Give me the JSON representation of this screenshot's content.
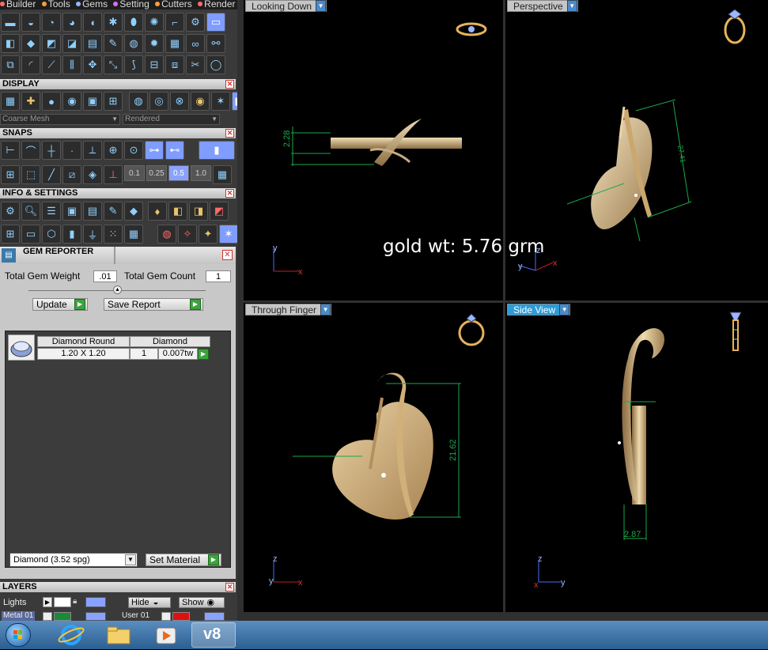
{
  "menubar": {
    "items": [
      {
        "label": "Builder"
      },
      {
        "label": "Tools"
      },
      {
        "label": "Gems"
      },
      {
        "label": "Setting"
      },
      {
        "label": "Cutters"
      },
      {
        "label": "Render"
      }
    ]
  },
  "display": {
    "title": "DISPLAY",
    "mesh_select": "Coarse Mesh",
    "render_select": "Rendered"
  },
  "snaps": {
    "title": "SNAPS",
    "values": [
      "0.1",
      "0.25",
      "0.5",
      "1.0"
    ],
    "selected": "0.5"
  },
  "info": {
    "title": "INFO & SETTINGS"
  },
  "gem_reporter": {
    "title": "GEM REPORTER",
    "total_weight_label": "Total Gem Weight",
    "total_weight_value": ".01",
    "total_count_label": "Total Gem Count",
    "total_count_value": "1",
    "update_label": "Update",
    "save_report_label": "Save Report",
    "columns": [
      "Diamond Round",
      "Diamond"
    ],
    "rows": [
      {
        "size": "1.20 X 1.20",
        "count": "1",
        "weight": "0.007tw"
      }
    ],
    "material_select": "Diamond    (3.52 spg)",
    "set_material_label": "Set Material"
  },
  "layers": {
    "title": "LAYERS",
    "row1_label": "Lights",
    "hide_label": "Hide",
    "show_label": "Show",
    "row2_left": "Metal 01",
    "row2_right": "User 01"
  },
  "viewports": {
    "top_left": {
      "label": "Looking Down",
      "dim": "2.28"
    },
    "top_right": {
      "label": "Perspective",
      "dim": "27.41"
    },
    "bottom_left": {
      "label": "Through Finger",
      "dim": "21.62"
    },
    "bottom_right": {
      "label": "Side View",
      "dim": "2.87"
    }
  },
  "overlay": {
    "gold_weight": "gold wt: 5.76 grm"
  },
  "axis_labels": {
    "x": "x",
    "y": "y",
    "z": "z"
  },
  "colors": {
    "metal": "#d8bd8a",
    "dimension_line": "#1aa84a",
    "tab_active": "#2c9cd9",
    "snap_selected": "#8aa2ff"
  },
  "taskbar": {
    "items": [
      "start-orb",
      "internet-explorer",
      "file-explorer",
      "media-player",
      "v8"
    ],
    "v8_label": "v8"
  }
}
